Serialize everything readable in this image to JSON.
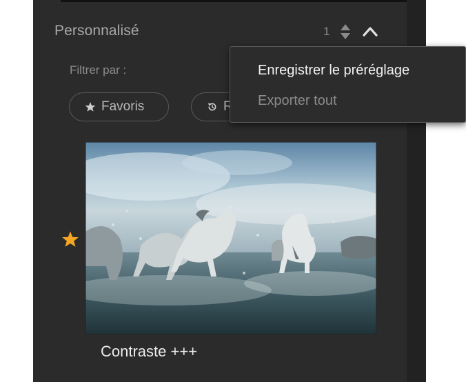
{
  "section": {
    "title": "Personnalisé",
    "count": "1"
  },
  "filter": {
    "label": "Filtrer par :",
    "chips": [
      {
        "label": "Favoris",
        "icon": "star-icon"
      },
      {
        "label": "R",
        "icon": "history-icon"
      }
    ]
  },
  "presets": [
    {
      "name": "Contraste +++",
      "favorite": true
    }
  ],
  "context_menu": {
    "items": [
      {
        "label": "Enregistrer le préréglage",
        "enabled": true
      },
      {
        "label": "Exporter tout",
        "enabled": false
      }
    ]
  },
  "colors": {
    "panel_bg": "#2b2b2b",
    "favorite_star": "#f5a623",
    "menu_bg": "#2c2c2c"
  }
}
